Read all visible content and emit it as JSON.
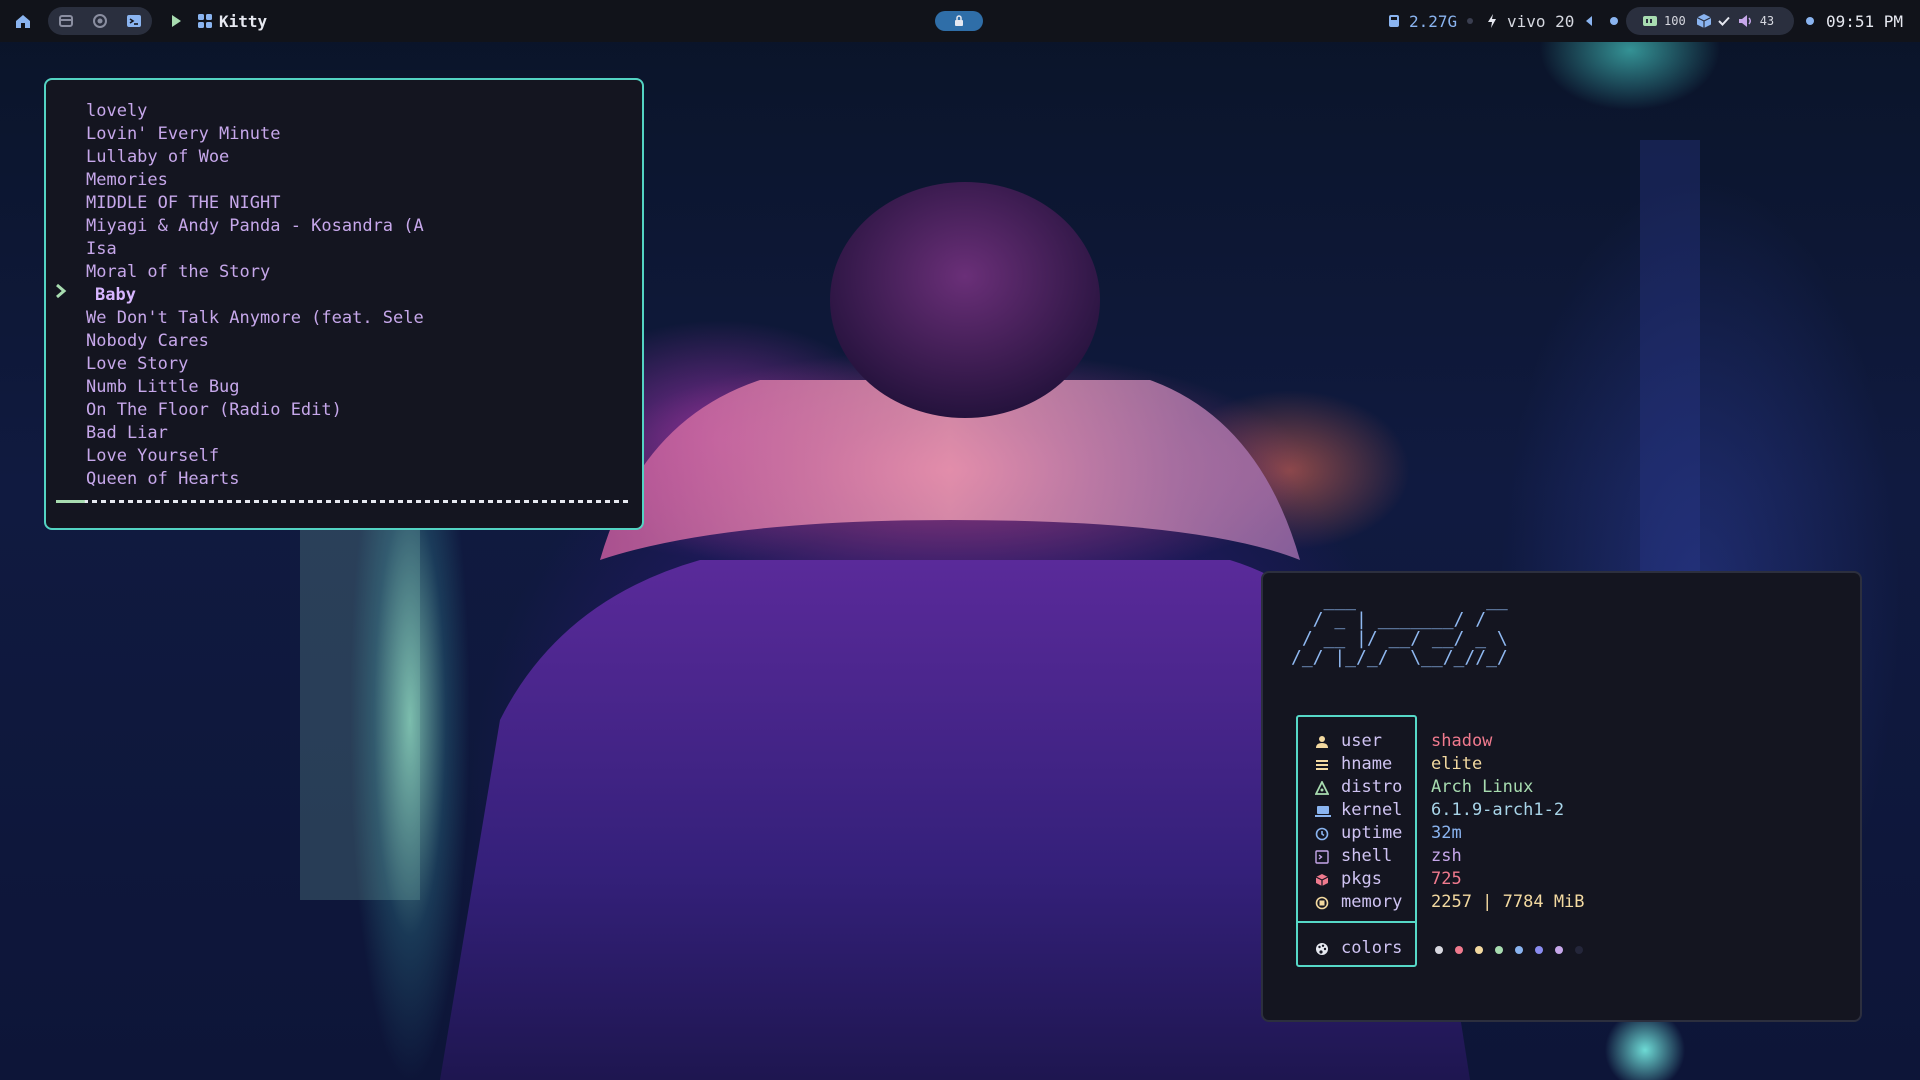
{
  "topbar": {
    "app_title": "Kitty",
    "storage": "2.27G",
    "battery_status": "vivo 20",
    "ram_badge": "100",
    "volume_level": "43",
    "clock": "09:51 PM",
    "icons": {
      "home": "home-icon",
      "files": "folder-icon",
      "browser": "browser-icon",
      "terminal": "terminal-icon",
      "play": "play-icon",
      "apps": "apps-grid-icon",
      "center": "lock-pill-icon",
      "storage": "disk-icon",
      "power": "bolt-icon",
      "volume": "speaker-icon"
    }
  },
  "playlist": {
    "songs": [
      "lovely",
      "Lovin' Every Minute",
      "Lullaby of Woe",
      "Memories",
      "MIDDLE OF THE NIGHT",
      "Miyagi & Andy Panda - Kosandra (A",
      "Isa",
      "Moral of the Story",
      "Baby",
      "We Don't Talk Anymore (feat. Sele",
      "Nobody Cares",
      "Love Story",
      "Numb Little Bug",
      "On The Floor (Radio Edit)",
      "Bad Liar",
      "Love Yourself",
      "Queen of Hearts"
    ],
    "selected_index": 8,
    "progress": 0.05
  },
  "fetch": {
    "ascii_logo": "   ___            __\n  / _ | _______/ /\n / __ |/ __/ __/ _ \\\n/_/ |_/_/  \\__/_//_/",
    "labels": {
      "user": "user",
      "hname": "hname",
      "distro": "distro",
      "kernel": "kernel",
      "uptime": "uptime",
      "shell": "shell",
      "pkgs": "pkgs",
      "memory": "memory",
      "colors": "colors"
    },
    "values": {
      "user": "shadow",
      "hname": "elite",
      "distro": "Arch Linux",
      "kernel": "6.1.9-arch1-2",
      "uptime": "32m",
      "shell": "zsh",
      "pkgs": "725",
      "memory": "2257 | 7784 MiB"
    },
    "value_colors": {
      "user": "#f07a8e",
      "hname": "#f3d9a0",
      "distro": "#a8dcb0",
      "kernel": "#a8d4e8",
      "uptime": "#8ab4f0",
      "shell": "#c6a7ea",
      "pkgs": "#f07a8e",
      "memory": "#f3d9a0"
    },
    "palette": [
      "#d8d8e0",
      "#f07a8e",
      "#f3d9a0",
      "#a8dcb0",
      "#8ab4f0",
      "#8a8cf0",
      "#c6a7ea",
      "#24263a"
    ]
  }
}
